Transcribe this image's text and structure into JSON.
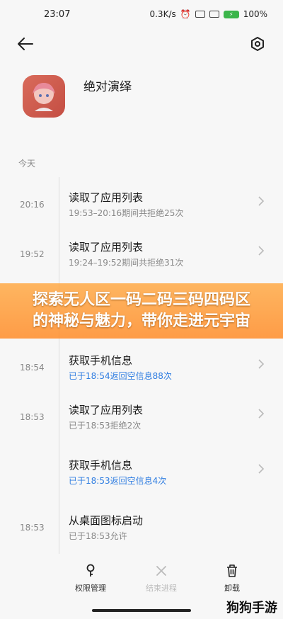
{
  "status_bar": {
    "time": "23:07",
    "net_speed": "0.3K/s",
    "battery": "100%",
    "battery_color": "#3bb54a"
  },
  "app_bar": {
    "back_icon": "back-arrow-icon",
    "settings_icon": "gear-icon"
  },
  "app": {
    "name": "绝对演绎",
    "avatar_color": "#d96b5b"
  },
  "section_label": "今天",
  "events": [
    {
      "time": "20:16",
      "title": "读取了应用列表",
      "detail": "19:53–20:16期间共拒绝25次",
      "detail_color": "gray"
    },
    {
      "time": "19:52",
      "title": "读取了应用列表",
      "detail": "19:24–19:52期间共拒绝31次",
      "detail_color": "gray"
    },
    {
      "time": "18:54",
      "title": "获取手机信息",
      "detail": "已于18:54返回空信息88次",
      "detail_color": "blue"
    },
    {
      "time": "18:53",
      "title": "读取了应用列表",
      "detail": "已于18:53拒绝2次",
      "detail_color": "gray"
    },
    {
      "time": "",
      "title": "获取手机信息",
      "detail": "已于18:53返回空信息4次",
      "detail_color": "blue"
    },
    {
      "time": "18:53",
      "title": "从桌面图标启动",
      "detail": "已于18:53允许",
      "detail_color": "gray"
    }
  ],
  "banner": {
    "line1": "探索无人区一码二码三码四码区",
    "line2": "的神秘与魅力，带你走进元宇宙",
    "color": "#ff9a3c"
  },
  "bottom_bar": {
    "permissions_label": "权限管理",
    "end_process_label": "结束进程",
    "uninstall_label": "卸载"
  },
  "watermark": "狗狗手游",
  "accent_blue": "#2f7de1"
}
